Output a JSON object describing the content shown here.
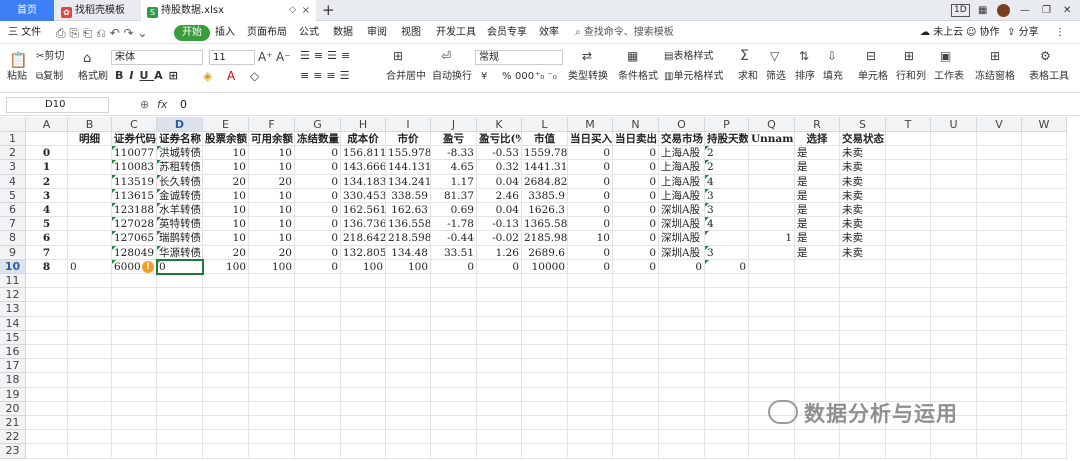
{
  "tabs": {
    "home": "首页",
    "find_template": "找稻壳模板",
    "file": "持股数据.xlsx",
    "file_badge": "S",
    "close": "×",
    "new_tab": "+"
  },
  "window": {
    "badge": "1D"
  },
  "menu": {
    "file": "三 文件",
    "start": "开始",
    "items": [
      "插入",
      "页面布局",
      "公式",
      "数据",
      "审阅",
      "视图",
      "开发工具",
      "会员专享",
      "效率"
    ],
    "search": "查找命令、搜索模板",
    "cloud": "未上云",
    "collab": "协作",
    "share": "分享"
  },
  "ribbon": {
    "cut": "剪切",
    "paste": "粘贴",
    "copy": "复制",
    "format_painter": "格式刷",
    "font_name": "宋体",
    "font_size": "11",
    "merge_center": "合并居中",
    "wrap": "自动换行",
    "number_format": "常规",
    "type_convert": "类型转换",
    "cond_format": "条件格式",
    "table_style": "表格样式",
    "cell_style": "单元格样式",
    "sum": "求和",
    "filter": "筛选",
    "sort": "排序",
    "fill": "填充",
    "cells": "单元格",
    "row_col": "行和列",
    "worksheet": "工作表",
    "freeze": "冻结窗格",
    "table_tools": "表格工具",
    "currency": "¥",
    "percent": "%",
    "thousand": "000"
  },
  "formula_bar": {
    "name_box": "D10",
    "fx": "fx",
    "value": "0"
  },
  "sheet": {
    "columns": [
      "A",
      "B",
      "C",
      "D",
      "E",
      "F",
      "G",
      "H",
      "I",
      "J",
      "K",
      "L",
      "M",
      "N",
      "O",
      "P",
      "Q",
      "R",
      "S",
      "T",
      "U",
      "V",
      "W"
    ],
    "rows": [
      "1",
      "2",
      "3",
      "4",
      "5",
      "6",
      "7",
      "8",
      "9",
      "10",
      "11",
      "12",
      "13",
      "14",
      "15",
      "16",
      "17",
      "18",
      "19",
      "20",
      "21",
      "22",
      "23"
    ],
    "header_row": [
      "",
      "明细",
      "证券代码",
      "证券名称",
      "股票余额",
      "可用余额",
      "冻结数量",
      "成本价",
      "市价",
      "盈亏",
      "盈亏比(%)",
      "市值",
      "当日买入",
      "当日卖出",
      "交易市场",
      "持股天数",
      "Unnamed:",
      "选择",
      "交易状态"
    ],
    "data": [
      [
        "0",
        "",
        "110077",
        "洪城转债",
        "10",
        "10",
        "0",
        "156.811",
        "155.978",
        "-8.33",
        "-0.53",
        "1559.78",
        "0",
        "0",
        "上海A股",
        "2",
        "",
        "是",
        "未卖"
      ],
      [
        "1",
        "",
        "110083",
        "苏租转债",
        "10",
        "10",
        "0",
        "143.666",
        "144.131",
        "4.65",
        "0.32",
        "1441.31",
        "0",
        "0",
        "上海A股",
        "2",
        "",
        "是",
        "未卖"
      ],
      [
        "2",
        "",
        "113519",
        "长久转债",
        "20",
        "20",
        "0",
        "134.183",
        "134.241",
        "1.17",
        "0.04",
        "2684.82",
        "0",
        "0",
        "上海A股",
        "4",
        "",
        "是",
        "未卖"
      ],
      [
        "3",
        "",
        "113615",
        "金诚转债",
        "10",
        "10",
        "0",
        "330.453",
        "338.59",
        "81.37",
        "2.46",
        "3385.9",
        "0",
        "0",
        "上海A股",
        "3",
        "",
        "是",
        "未卖"
      ],
      [
        "4",
        "",
        "123188",
        "水羊转债",
        "10",
        "10",
        "0",
        "162.561",
        "162.63",
        "0.69",
        "0.04",
        "1626.3",
        "0",
        "0",
        "深圳A股",
        "3",
        "",
        "是",
        "未卖"
      ],
      [
        "5",
        "",
        "127028",
        "英特转债",
        "10",
        "10",
        "0",
        "136.736",
        "136.558",
        "-1.78",
        "-0.13",
        "1365.58",
        "0",
        "0",
        "深圳A股",
        "4",
        "",
        "是",
        "未卖"
      ],
      [
        "6",
        "",
        "127065",
        "瑞鹊转债",
        "10",
        "10",
        "0",
        "218.642",
        "218.598",
        "-0.44",
        "-0.02",
        "2185.98",
        "10",
        "0",
        "深圳A股",
        "",
        "1",
        "是",
        "未卖"
      ],
      [
        "7",
        "",
        "128049",
        "华源转债",
        "20",
        "20",
        "0",
        "132.805",
        "134.48",
        "33.51",
        "1.26",
        "2689.6",
        "0",
        "0",
        "深圳A股",
        "3",
        "",
        "是",
        "未卖"
      ],
      [
        "8",
        "0",
        "6000",
        "0",
        "100",
        "100",
        "0",
        "100",
        "100",
        "0",
        "0",
        "10000",
        "0",
        "0",
        "0",
        "0",
        "",
        "",
        ""
      ]
    ]
  },
  "watermark": "数据分析与运用",
  "colors": {
    "accent_green": "#3a9c3a",
    "home_tab": "#3d7ff6",
    "active_border": "#1e7a3a"
  }
}
